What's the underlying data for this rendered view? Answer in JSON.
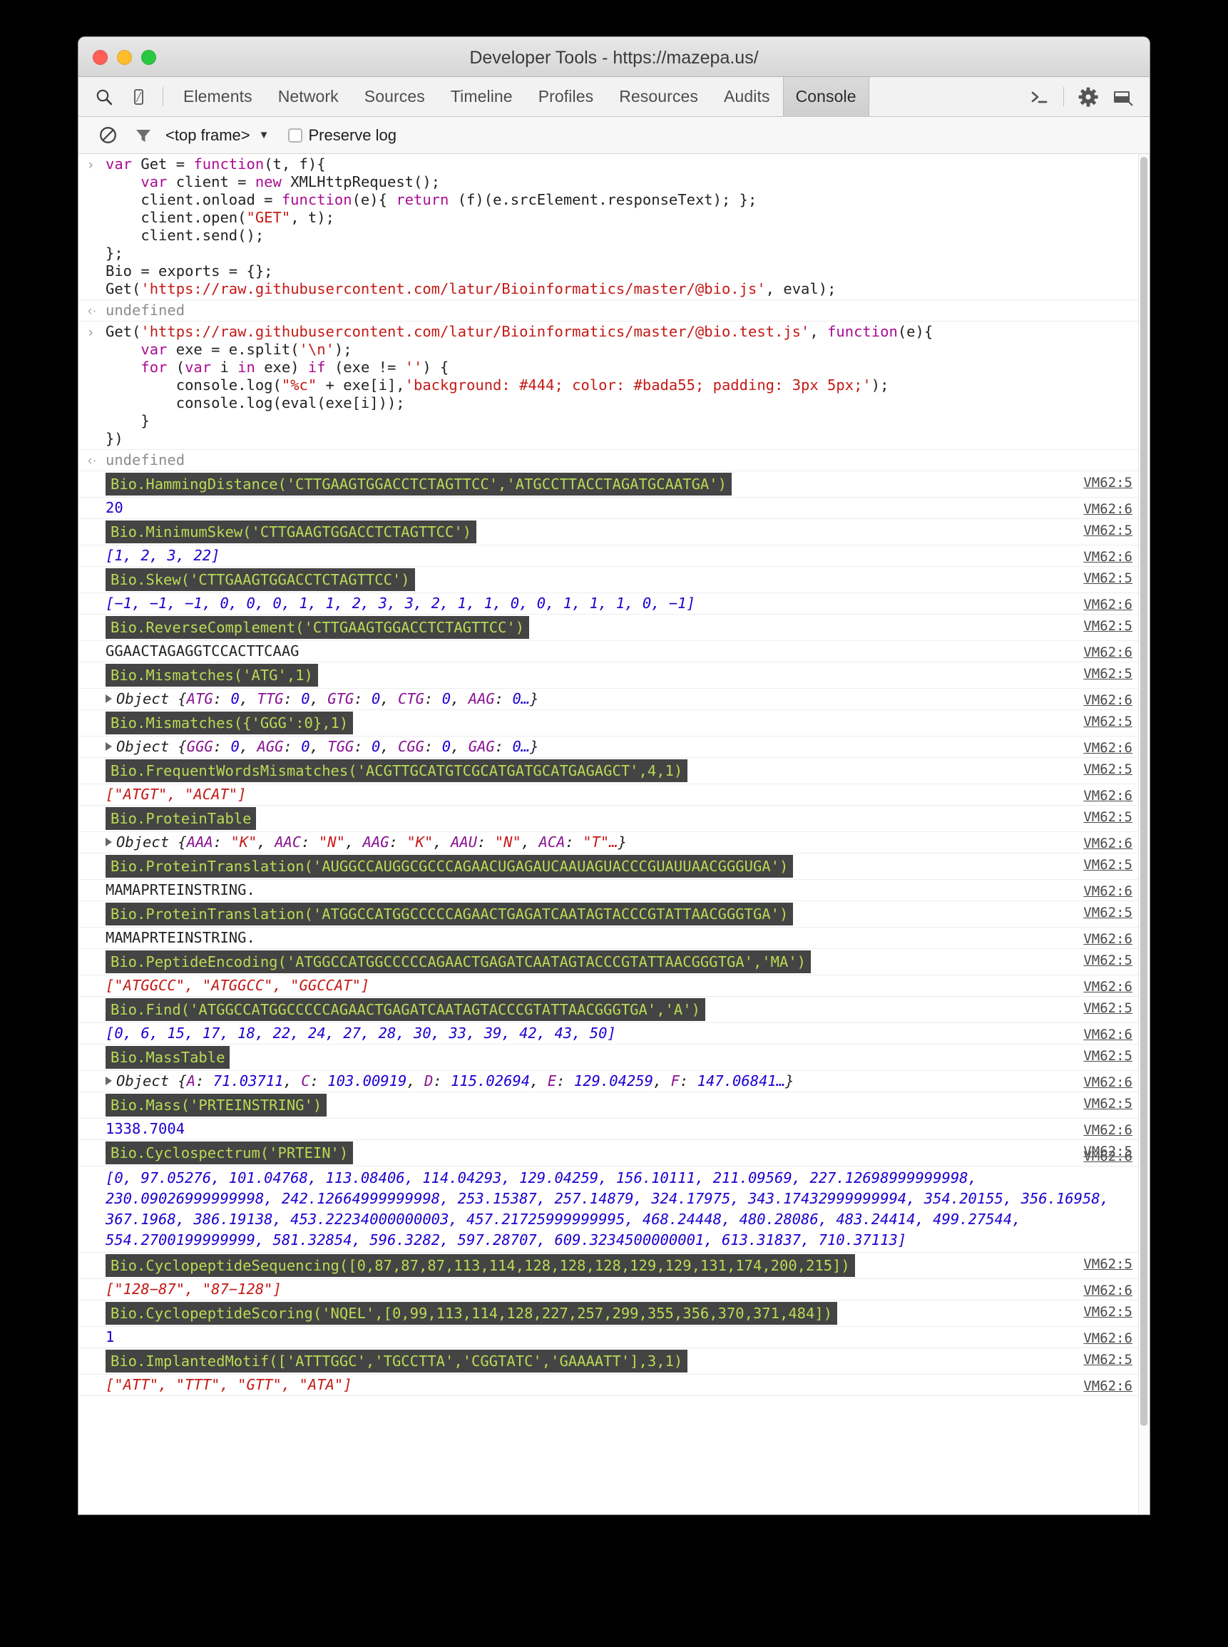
{
  "window": {
    "title": "Developer Tools - https://mazepa.us/",
    "traffic_lights": [
      "close",
      "minimize",
      "zoom"
    ]
  },
  "toolbar": {
    "left_icons": [
      "search-icon",
      "device-mode-icon"
    ],
    "tabs": [
      {
        "label": "Elements",
        "selected": false
      },
      {
        "label": "Network",
        "selected": false
      },
      {
        "label": "Sources",
        "selected": false
      },
      {
        "label": "Timeline",
        "selected": false
      },
      {
        "label": "Profiles",
        "selected": false
      },
      {
        "label": "Resources",
        "selected": false
      },
      {
        "label": "Audits",
        "selected": false
      },
      {
        "label": "Console",
        "selected": true
      }
    ],
    "right_icons": [
      "console-drawer-icon",
      "settings-gear-icon",
      "dock-side-icon"
    ]
  },
  "filterbar": {
    "clear_icon": "clear-console-icon",
    "filter_icon": "filter-icon",
    "frame_selected": "<top frame>",
    "frame_caret": "▼",
    "preserve_log_label": "Preserve log",
    "preserve_log_checked": false
  },
  "colors": {
    "log_tag_bg": "#444444",
    "log_tag_fg": "#bada55",
    "string": "#c41a16",
    "number": "#1c00cf",
    "keyword": "#aa0d91",
    "property": "#881391",
    "link": "#4a4a4a"
  },
  "console": {
    "inputs": {
      "block1": {
        "lines": [
          {
            "segs": [
              {
                "t": "var ",
                "c": "kw"
              },
              {
                "t": "Get = ",
                "c": "plain"
              },
              {
                "t": "function",
                "c": "kw"
              },
              {
                "t": "(t, f){",
                "c": "plain"
              }
            ]
          },
          {
            "segs": [
              {
                "t": "    var ",
                "c": "kw"
              },
              {
                "t": "client = ",
                "c": "plain"
              },
              {
                "t": "new ",
                "c": "kw"
              },
              {
                "t": "XMLHttpRequest();",
                "c": "plain"
              }
            ]
          },
          {
            "segs": [
              {
                "t": "    client.onload = ",
                "c": "plain"
              },
              {
                "t": "function",
                "c": "kw"
              },
              {
                "t": "(e){ ",
                "c": "plain"
              },
              {
                "t": "return ",
                "c": "kw"
              },
              {
                "t": "(f)(e.srcElement.responseText); };",
                "c": "plain"
              }
            ]
          },
          {
            "segs": [
              {
                "t": "    client.open(",
                "c": "plain"
              },
              {
                "t": "\"GET\"",
                "c": "str"
              },
              {
                "t": ", t);",
                "c": "plain"
              }
            ]
          },
          {
            "segs": [
              {
                "t": "    client.send();",
                "c": "plain"
              }
            ]
          },
          {
            "segs": [
              {
                "t": "};",
                "c": "plain"
              }
            ]
          },
          {
            "segs": [
              {
                "t": "Bio = exports = {};",
                "c": "plain"
              }
            ]
          },
          {
            "segs": [
              {
                "t": "Get(",
                "c": "plain"
              },
              {
                "t": "'https://raw.githubusercontent.com/latur/Bioinformatics/master/@bio.js'",
                "c": "str"
              },
              {
                "t": ", eval);",
                "c": "plain"
              }
            ]
          }
        ],
        "result": "undefined"
      },
      "block2": {
        "lines": [
          {
            "segs": [
              {
                "t": "Get(",
                "c": "plain"
              },
              {
                "t": "'https://raw.githubusercontent.com/latur/Bioinformatics/master/@bio.test.js'",
                "c": "str"
              },
              {
                "t": ", ",
                "c": "plain"
              },
              {
                "t": "function",
                "c": "kw"
              },
              {
                "t": "(e){",
                "c": "plain"
              }
            ]
          },
          {
            "segs": [
              {
                "t": "    var ",
                "c": "kw"
              },
              {
                "t": "exe = e.split(",
                "c": "plain"
              },
              {
                "t": "'\\n'",
                "c": "str"
              },
              {
                "t": ");",
                "c": "plain"
              }
            ]
          },
          {
            "segs": [
              {
                "t": "    for ",
                "c": "kw"
              },
              {
                "t": "(",
                "c": "plain"
              },
              {
                "t": "var ",
                "c": "kw"
              },
              {
                "t": "i ",
                "c": "plain"
              },
              {
                "t": "in ",
                "c": "kw"
              },
              {
                "t": "exe) ",
                "c": "plain"
              },
              {
                "t": "if ",
                "c": "kw"
              },
              {
                "t": "(exe != ",
                "c": "plain"
              },
              {
                "t": "''",
                "c": "str"
              },
              {
                "t": ") {",
                "c": "plain"
              }
            ]
          },
          {
            "segs": [
              {
                "t": "        console.log(",
                "c": "plain"
              },
              {
                "t": "\"%c\"",
                "c": "str"
              },
              {
                "t": " + exe[i],",
                "c": "plain"
              },
              {
                "t": "'background: #444; color: #bada55; padding: 3px 5px;'",
                "c": "str"
              },
              {
                "t": ");",
                "c": "plain"
              }
            ]
          },
          {
            "segs": [
              {
                "t": "        console.log(eval(exe[i]));",
                "c": "plain"
              }
            ]
          },
          {
            "segs": [
              {
                "t": "    }",
                "c": "plain"
              }
            ]
          },
          {
            "segs": [
              {
                "t": "})",
                "c": "plain"
              }
            ]
          }
        ],
        "result": "undefined"
      }
    },
    "log_entries": [
      {
        "kind": "tag",
        "text": "Bio.HammingDistance('CTTGAAGTGGACCTCTAGTTCC','ATGCCTTACCTAGATGCAATGA')",
        "vm": "VM62:5"
      },
      {
        "kind": "num",
        "text": "20",
        "vm": "VM62:6"
      },
      {
        "kind": "tag",
        "text": "Bio.MinimumSkew('CTTGAAGTGGACCTCTAGTTCC')",
        "vm": "VM62:5"
      },
      {
        "kind": "arr",
        "text": "[1, 2, 3, 22]",
        "vm": "VM62:6"
      },
      {
        "kind": "tag",
        "text": "Bio.Skew('CTTGAAGTGGACCTCTAGTTCC')",
        "vm": "VM62:5"
      },
      {
        "kind": "arr",
        "text": "[−1, −1, −1, 0, 0, 0, 1, 1, 2, 3, 3, 2, 1, 1, 0, 0, 1, 1, 1, 0, −1]",
        "vm": "VM62:6"
      },
      {
        "kind": "tag",
        "text": "Bio.ReverseComplement('CTTGAAGTGGACCTCTAGTTCC')",
        "vm": "VM62:5"
      },
      {
        "kind": "text",
        "text": "GGAACTAGAGGTCCACTTCAAG",
        "vm": "VM62:6"
      },
      {
        "kind": "tag",
        "text": "Bio.Mismatches('ATG',1)",
        "vm": "VM62:5"
      },
      {
        "kind": "object",
        "label": "Object",
        "props": [
          {
            "k": "ATG",
            "v": "0",
            "vt": "num"
          },
          {
            "k": "TTG",
            "v": "0",
            "vt": "num"
          },
          {
            "k": "GTG",
            "v": "0",
            "vt": "num"
          },
          {
            "k": "CTG",
            "v": "0",
            "vt": "num"
          },
          {
            "k": "AAG",
            "v": "0…",
            "vt": "num"
          }
        ],
        "vm": "VM62:6"
      },
      {
        "kind": "tag",
        "text": "Bio.Mismatches({'GGG':0},1)",
        "vm": "VM62:5"
      },
      {
        "kind": "object",
        "label": "Object",
        "props": [
          {
            "k": "GGG",
            "v": "0",
            "vt": "num"
          },
          {
            "k": "AGG",
            "v": "0",
            "vt": "num"
          },
          {
            "k": "TGG",
            "v": "0",
            "vt": "num"
          },
          {
            "k": "CGG",
            "v": "0",
            "vt": "num"
          },
          {
            "k": "GAG",
            "v": "0…",
            "vt": "num"
          }
        ],
        "vm": "VM62:6"
      },
      {
        "kind": "tag",
        "text": "Bio.FrequentWordsMismatches('ACGTTGCATGTCGCATGATGCATGAGAGCT',4,1)",
        "vm": "VM62:5"
      },
      {
        "kind": "strarr",
        "text": "[\"ATGT\", \"ACAT\"]",
        "vm": "VM62:6"
      },
      {
        "kind": "tag",
        "text": "Bio.ProteinTable",
        "vm": "VM62:5"
      },
      {
        "kind": "object",
        "label": "Object",
        "props": [
          {
            "k": "AAA",
            "v": "\"K\"",
            "vt": "str"
          },
          {
            "k": "AAC",
            "v": "\"N\"",
            "vt": "str"
          },
          {
            "k": "AAG",
            "v": "\"K\"",
            "vt": "str"
          },
          {
            "k": "AAU",
            "v": "\"N\"",
            "vt": "str"
          },
          {
            "k": "ACA",
            "v": "\"T\"…",
            "vt": "str"
          }
        ],
        "vm": "VM62:6"
      },
      {
        "kind": "tag",
        "text": "Bio.ProteinTranslation('AUGGCCAUGGCGCCCAGAACUGAGAUCAAUAGUACCCGUAUUAACGGGUGA')",
        "vm": "VM62:5"
      },
      {
        "kind": "text",
        "text": "MAMAPRTEINSTRING.",
        "vm": "VM62:6"
      },
      {
        "kind": "tag",
        "text": "Bio.ProteinTranslation('ATGGCCATGGCCCCCAGAACTGAGATCAATAGTACCCGTATTAACGGGTGA')",
        "vm": "VM62:5"
      },
      {
        "kind": "text",
        "text": "MAMAPRTEINSTRING.",
        "vm": "VM62:6"
      },
      {
        "kind": "tag",
        "text": "Bio.PeptideEncoding('ATGGCCATGGCCCCCAGAACTGAGATCAATAGTACCCGTATTAACGGGTGA','MA')",
        "vm": "VM62:5"
      },
      {
        "kind": "strarr",
        "text": "[\"ATGGCC\", \"ATGGCC\", \"GGCCAT\"]",
        "vm": "VM62:6"
      },
      {
        "kind": "tag",
        "text": "Bio.Find('ATGGCCATGGCCCCCAGAACTGAGATCAATAGTACCCGTATTAACGGGTGA','A')",
        "vm": "VM62:5"
      },
      {
        "kind": "arr",
        "text": "[0, 6, 15, 17, 18, 22, 24, 27, 28, 30, 33, 39, 42, 43, 50]",
        "vm": "VM62:6"
      },
      {
        "kind": "tag",
        "text": "Bio.MassTable",
        "vm": "VM62:5"
      },
      {
        "kind": "object",
        "label": "Object",
        "props": [
          {
            "k": "A",
            "v": "71.03711",
            "vt": "num"
          },
          {
            "k": "C",
            "v": "103.00919",
            "vt": "num"
          },
          {
            "k": "D",
            "v": "115.02694",
            "vt": "num"
          },
          {
            "k": "E",
            "v": "129.04259",
            "vt": "num"
          },
          {
            "k": "F",
            "v": "147.06841…",
            "vt": "num"
          }
        ],
        "vm": "VM62:6"
      },
      {
        "kind": "tag",
        "text": "Bio.Mass('PRTEINSTRING')",
        "vm": "VM62:5"
      },
      {
        "kind": "num",
        "text": "1338.7004",
        "vm": "VM62:6"
      },
      {
        "kind": "tag",
        "text": "Bio.Cyclospectrum('PRTEIN')",
        "vm": "VM62:5"
      },
      {
        "kind": "bigarray",
        "text": "[0, 97.05276, 101.04768, 113.08406, 114.04293, 129.04259, 156.10111, 211.09569, 227.12698999999998, 230.09026999999998, 242.12664999999998, 253.15387, 257.14879, 324.17975, 343.17432999999994, 354.20155, 356.16958, 367.1968, 386.19138, 453.22234000000003, 457.21725999999995, 468.24448, 480.28086, 483.24414, 499.27544, 554.2700199999999, 581.32854, 596.3282, 597.28707, 609.3234500000001, 613.31837, 710.37113]",
        "vm": "VM62:6"
      },
      {
        "kind": "tag",
        "text": "Bio.CyclopeptideSequencing([0,87,87,87,113,114,128,128,128,129,129,131,174,200,215])",
        "vm": "VM62:5"
      },
      {
        "kind": "strarr",
        "text": "[\"128−87\", \"87−128\"]",
        "vm": "VM62:6"
      },
      {
        "kind": "tag",
        "text": "Bio.CyclopeptideScoring('NQEL',[0,99,113,114,128,227,257,299,355,356,370,371,484])",
        "vm": "VM62:5"
      },
      {
        "kind": "num",
        "text": "1",
        "vm": "VM62:6"
      },
      {
        "kind": "tag",
        "text": "Bio.ImplantedMotif(['ATTTGGC','TGCCTTA','CGGTATC','GAAAATT'],3,1)",
        "vm": "VM62:5"
      },
      {
        "kind": "strarr",
        "text": "[\"ATT\", \"TTT\", \"GTT\", \"ATA\"]",
        "vm": "VM62:6"
      }
    ]
  }
}
